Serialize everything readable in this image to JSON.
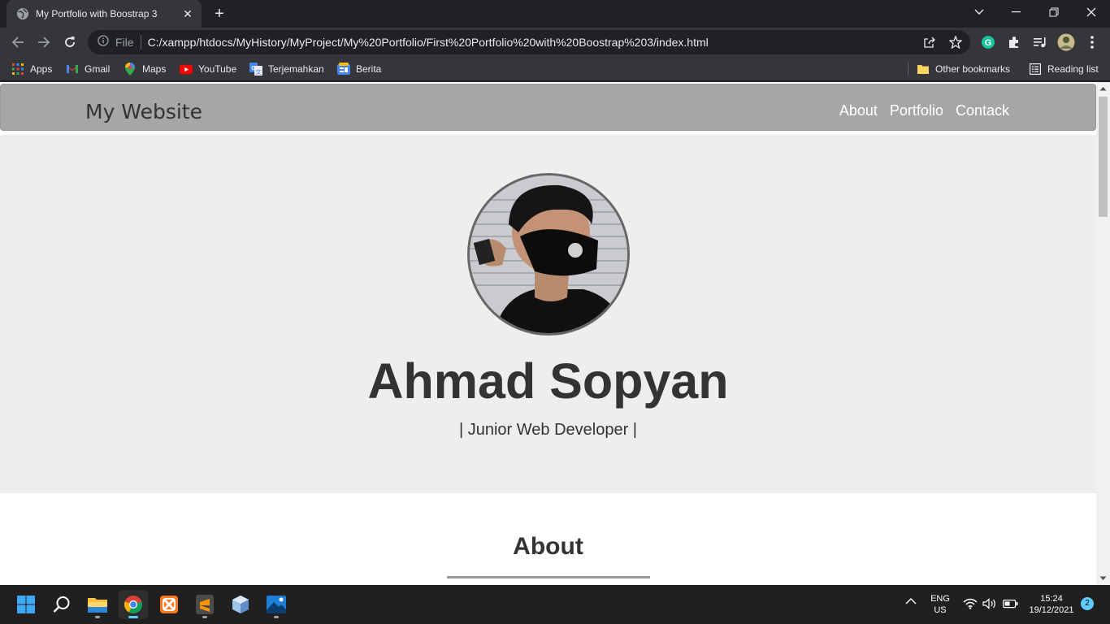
{
  "browser": {
    "tab_title": "My Portfolio with Boostrap 3",
    "tab_close": "✕",
    "new_tab": "+",
    "omnibox_scheme": "File",
    "url": "C:/xampp/htdocs/MyHistory/MyProject/My%20Portfolio/First%20Portfolio%20with%20Boostrap%203/index.html"
  },
  "bookmarks": {
    "items": [
      {
        "label": "Apps",
        "icon": "apps-grid-icon"
      },
      {
        "label": "Gmail",
        "icon": "gmail-icon"
      },
      {
        "label": "Maps",
        "icon": "maps-pin-icon"
      },
      {
        "label": "YouTube",
        "icon": "youtube-icon"
      },
      {
        "label": "Terjemahkan",
        "icon": "translate-icon"
      },
      {
        "label": "Berita",
        "icon": "news-icon"
      }
    ],
    "other": "Other bookmarks",
    "reading_list": "Reading list"
  },
  "site": {
    "brand": "My Website",
    "nav": [
      "About",
      "Portfolio",
      "Contack"
    ],
    "name": "Ahmad Sopyan",
    "role": "| Junior Web Developer |",
    "about_heading": "About"
  },
  "taskbar": {
    "lang": "ENG",
    "region": "US",
    "time": "15:24",
    "date": "19/12/2021",
    "notifications": "2"
  },
  "colors": {
    "navbar": "#a6a6a6",
    "jumbotron": "#eeeeee",
    "accent": "#60cdff"
  }
}
